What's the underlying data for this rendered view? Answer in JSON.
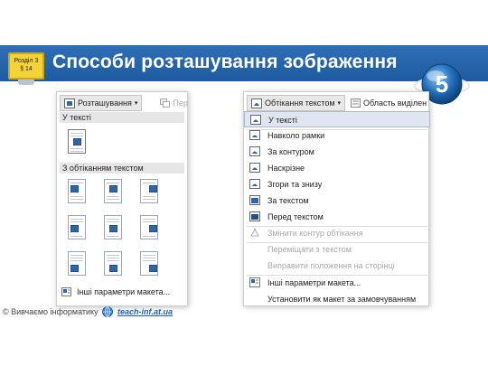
{
  "slide": {
    "title": "Способи розташування зображення",
    "section_badge": [
      "Розділ 3",
      "§ 14"
    ],
    "grade_logo": "5"
  },
  "left_panel": {
    "toolbar_label": "Розташування",
    "toolbar_dim": "Пер",
    "group_inline": "У тексті",
    "group_wrap": "З обтіканням текстом",
    "footer_link": "Інші параметри макета..."
  },
  "right_panel": {
    "toolbar_label": "Обтікання текстом",
    "toolbar_dim": "Область виділен",
    "items": [
      {
        "label": "У тексті",
        "icon": "wrap-inline-icon",
        "enabled": true,
        "highlighted": true
      },
      {
        "label": "Навколо рамки",
        "icon": "wrap-square-icon",
        "enabled": true
      },
      {
        "label": "За контуром",
        "icon": "wrap-tight-icon",
        "enabled": true
      },
      {
        "label": "Наскрізне",
        "icon": "wrap-through-icon",
        "enabled": true
      },
      {
        "label": "Згори та знизу",
        "icon": "wrap-top-bottom-icon",
        "enabled": true
      },
      {
        "label": "За текстом",
        "icon": "behind-text-icon",
        "enabled": true
      },
      {
        "label": "Перед текстом",
        "icon": "in-front-of-text-icon",
        "enabled": true
      },
      {
        "label": "Змінити контур обтікання",
        "icon": "edit-wrap-points-icon",
        "enabled": false
      },
      {
        "label": "Переміщати з текстом",
        "enabled": false
      },
      {
        "label": "Виправити положення на сторінці",
        "enabled": false
      },
      {
        "label": "Інші параметри макета...",
        "icon": "layout-options-icon",
        "enabled": true
      },
      {
        "label": "Установити як макет за замовчуванням",
        "enabled": true
      }
    ]
  },
  "footer": {
    "copyright": "© Вивчаємо інформатику",
    "site": "teach-inf.at.ua"
  },
  "colors": {
    "title_band": "#2f6fb6",
    "link": "#1d5fb8",
    "badge": "#f4d23a"
  }
}
